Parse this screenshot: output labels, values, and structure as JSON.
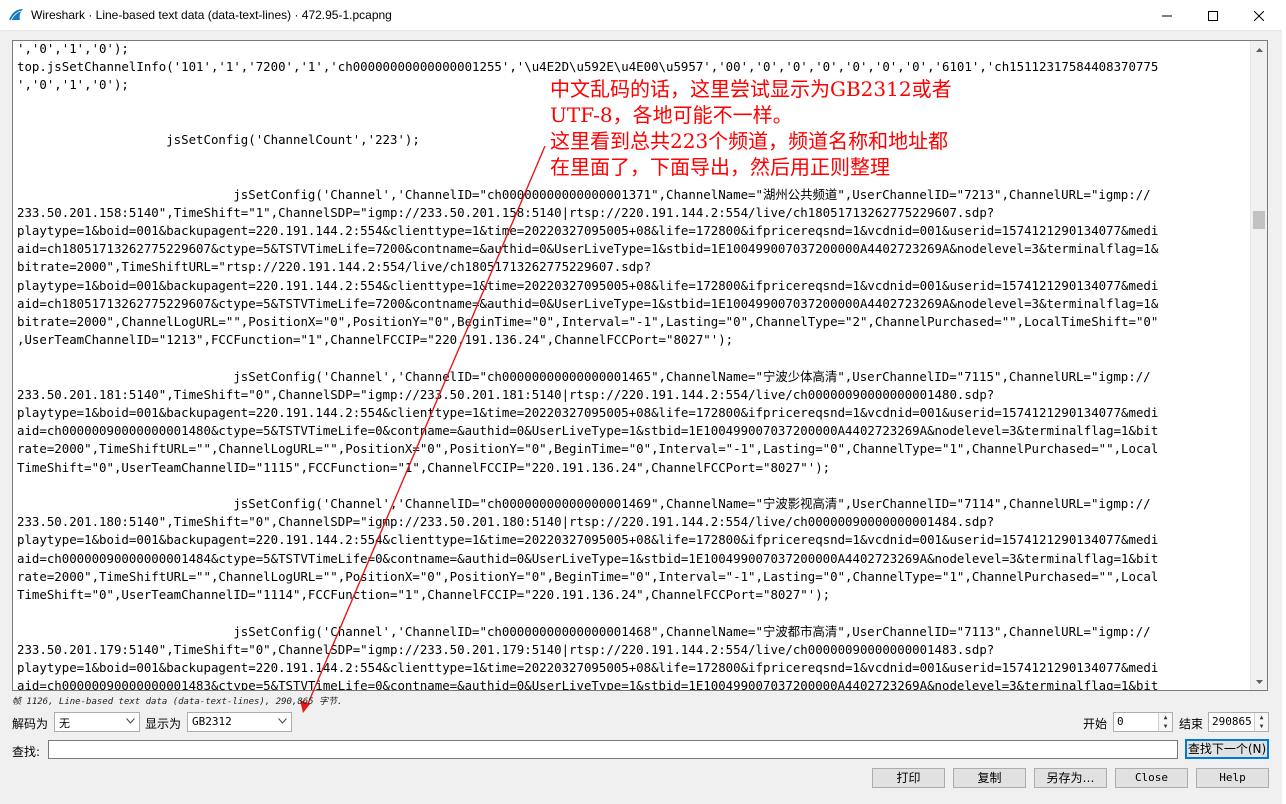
{
  "window": {
    "title": "Wireshark · Line-based text data (data-text-lines) · 472.95-1.pcapng",
    "minimize_icon": "minimize-icon",
    "maximize_icon": "maximize-icon",
    "close_icon": "close-icon",
    "app_icon": "wireshark-fin-icon"
  },
  "viewer": {
    "lines": [
      "','0','1','0');",
      "top.jsSetChannelInfo('101','1','7200','1','ch00000000000000001255','\\u4E2D\\u592E\\u4E00\\u5957','00','0','0','0','0','0','0','6101','ch15112317584408370775",
      "','0','1','0');",
      "",
      "",
      "                    jsSetConfig('ChannelCount','223');",
      "",
      "",
      "                             jsSetConfig('Channel','ChannelID=\"ch00000000000000001371\",ChannelName=\"湖州公共频道\",UserChannelID=\"7213\",ChannelURL=\"igmp://",
      "233.50.201.158:5140\",TimeShift=\"1\",ChannelSDP=\"igmp://233.50.201.158:5140|rtsp://220.191.144.2:554/live/ch18051713262775229607.sdp?",
      "playtype=1&boid=001&backupagent=220.191.144.2:554&clienttype=1&time=20220327095005+08&life=172800&ifpricereqsnd=1&vcdnid=001&userid=1574121290134077&medi",
      "aid=ch18051713262775229607&ctype=5&TSTVTimeLife=7200&contname=&authid=0&UserLiveType=1&stbid=1E100499007037200000A4402723269A&nodelevel=3&terminalflag=1&",
      "bitrate=2000\",TimeShiftURL=\"rtsp://220.191.144.2:554/live/ch18051713262775229607.sdp?",
      "playtype=1&boid=001&backupagent=220.191.144.2:554&clienttype=1&time=20220327095005+08&life=172800&ifpricereqsnd=1&vcdnid=001&userid=1574121290134077&medi",
      "aid=ch18051713262775229607&ctype=5&TSTVTimeLife=7200&contname=&authid=0&UserLiveType=1&stbid=1E100499007037200000A4402723269A&nodelevel=3&terminalflag=1&",
      "bitrate=2000\",ChannelLogURL=\"\",PositionX=\"0\",PositionY=\"0\",BeginTime=\"0\",Interval=\"-1\",Lasting=\"0\",ChannelType=\"2\",ChannelPurchased=\"\",LocalTimeShift=\"0\"",
      ",UserTeamChannelID=\"1213\",FCCFunction=\"1\",ChannelFCCIP=\"220.191.136.24\",ChannelFCCPort=\"8027\"');",
      "",
      "                             jsSetConfig('Channel','ChannelID=\"ch00000000000000001465\",ChannelName=\"宁波少体高清\",UserChannelID=\"7115\",ChannelURL=\"igmp://",
      "233.50.201.181:5140\",TimeShift=\"0\",ChannelSDP=\"igmp://233.50.201.181:5140|rtsp://220.191.144.2:554/live/ch00000090000000001480.sdp?",
      "playtype=1&boid=001&backupagent=220.191.144.2:554&clienttype=1&time=20220327095005+08&life=172800&ifpricereqsnd=1&vcdnid=001&userid=1574121290134077&medi",
      "aid=ch00000090000000001480&ctype=5&TSTVTimeLife=0&contname=&authid=0&UserLiveType=1&stbid=1E100499007037200000A4402723269A&nodelevel=3&terminalflag=1&bit",
      "rate=2000\",TimeShiftURL=\"\",ChannelLogURL=\"\",PositionX=\"0\",PositionY=\"0\",BeginTime=\"0\",Interval=\"-1\",Lasting=\"0\",ChannelType=\"1\",ChannelPurchased=\"\",Local",
      "TimeShift=\"0\",UserTeamChannelID=\"1115\",FCCFunction=\"1\",ChannelFCCIP=\"220.191.136.24\",ChannelFCCPort=\"8027\"');",
      "",
      "                             jsSetConfig('Channel','ChannelID=\"ch00000000000000001469\",ChannelName=\"宁波影视高清\",UserChannelID=\"7114\",ChannelURL=\"igmp://",
      "233.50.201.180:5140\",TimeShift=\"0\",ChannelSDP=\"igmp://233.50.201.180:5140|rtsp://220.191.144.2:554/live/ch00000090000000001484.sdp?",
      "playtype=1&boid=001&backupagent=220.191.144.2:554&clienttype=1&time=20220327095005+08&life=172800&ifpricereqsnd=1&vcdnid=001&userid=1574121290134077&medi",
      "aid=ch00000090000000001484&ctype=5&TSTVTimeLife=0&contname=&authid=0&UserLiveType=1&stbid=1E100499007037200000A4402723269A&nodelevel=3&terminalflag=1&bit",
      "rate=2000\",TimeShiftURL=\"\",ChannelLogURL=\"\",PositionX=\"0\",PositionY=\"0\",BeginTime=\"0\",Interval=\"-1\",Lasting=\"0\",ChannelType=\"1\",ChannelPurchased=\"\",Local",
      "TimeShift=\"0\",UserTeamChannelID=\"1114\",FCCFunction=\"1\",ChannelFCCIP=\"220.191.136.24\",ChannelFCCPort=\"8027\"');",
      "",
      "                             jsSetConfig('Channel','ChannelID=\"ch00000000000000001468\",ChannelName=\"宁波都市高清\",UserChannelID=\"7113\",ChannelURL=\"igmp://",
      "233.50.201.179:5140\",TimeShift=\"0\",ChannelSDP=\"igmp://233.50.201.179:5140|rtsp://220.191.144.2:554/live/ch00000090000000001483.sdp?",
      "playtype=1&boid=001&backupagent=220.191.144.2:554&clienttype=1&time=20220327095005+08&life=172800&ifpricereqsnd=1&vcdnid=001&userid=1574121290134077&medi",
      "aid=ch00000090000000001483&ctype=5&TSTVTimeLife=0&contname=&authid=0&UserLiveType=1&stbid=1E100499007037200000A4402723269A&nodelevel=3&terminalflag=1&bit"
    ]
  },
  "annotation": {
    "lines": [
      "中文乱码的话，这里尝试显示为GB2312或者",
      "UTF-8，各地可能不一样。",
      "这里看到总共223个频道，频道名称和地址都",
      "在里面了，下面导出，然后用正则整理"
    ],
    "color": "#ff0000"
  },
  "status": {
    "text": "帧 1126, Line-based text data (data-text-lines), 290,865 字节."
  },
  "controls": {
    "decode_label": "解码为",
    "decode_value": "无",
    "show_as_label": "显示为",
    "show_as_value": "GB2312",
    "start_label": "开始",
    "start_value": "0",
    "end_label": "结束",
    "end_value": "290865",
    "find_label": "查找:",
    "find_value": "",
    "find_next_label": "查找下一个(N)"
  },
  "buttons": {
    "print": "打印",
    "copy": "复制",
    "save_as": "另存为…",
    "close": "Close",
    "help": "Help"
  }
}
